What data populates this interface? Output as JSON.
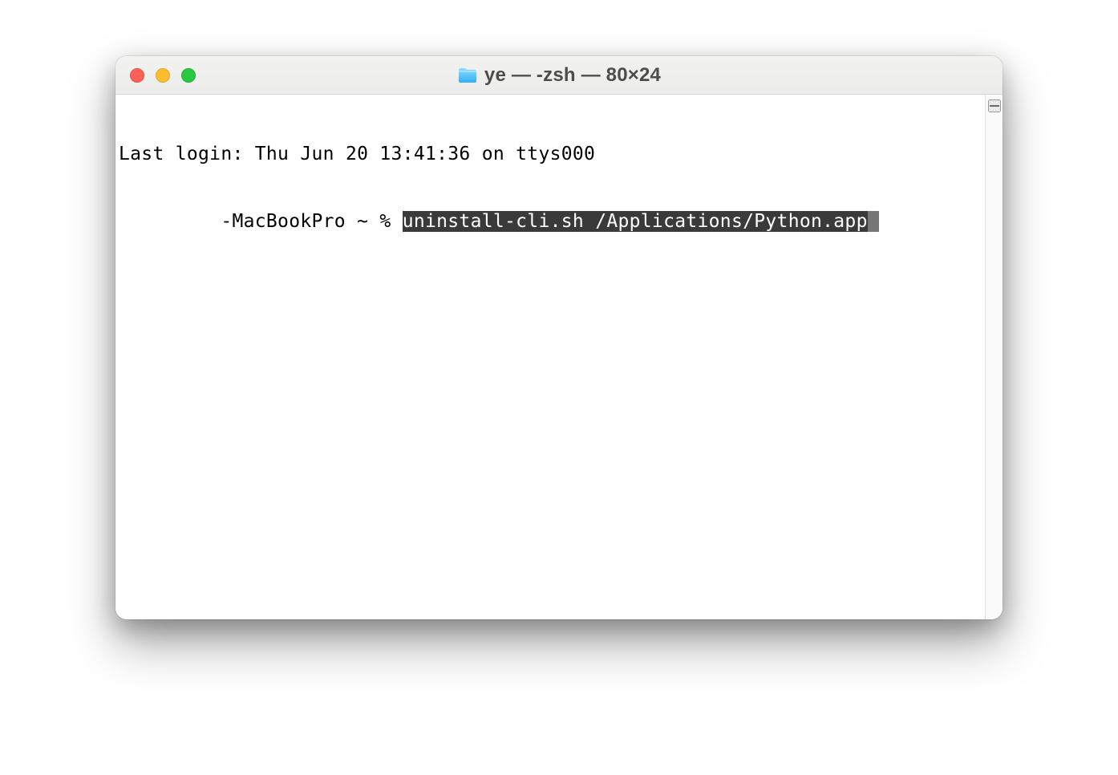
{
  "window": {
    "title": "ye — -zsh — 80×24"
  },
  "terminal": {
    "line1": "Last login: Thu Jun 20 13:41:36 on ttys000",
    "prompt_prefix": "         -MacBookPro ~ % ",
    "command_highlight": "uninstall-cli.sh /Applications/Python.app"
  }
}
